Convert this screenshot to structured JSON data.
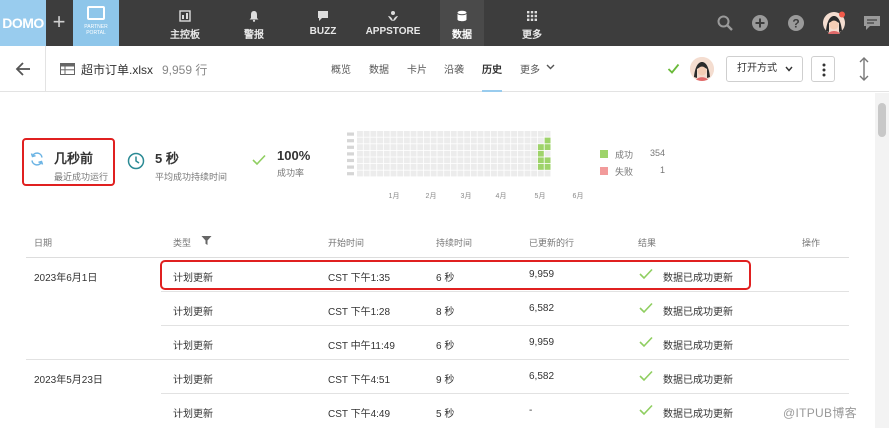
{
  "topnav": {
    "logo": "DOMO",
    "portal": {
      "line1": "PARTNER",
      "line2": "PORTAL"
    },
    "items": [
      {
        "label": "主控板",
        "icon": "dashboard-icon"
      },
      {
        "label": "警报",
        "icon": "bell-icon"
      },
      {
        "label": "BUZZ",
        "icon": "chat-icon"
      },
      {
        "label": "APPSTORE",
        "icon": "appstore-icon"
      },
      {
        "label": "数据",
        "icon": "database-icon",
        "active": true
      },
      {
        "label": "更多",
        "icon": "grid-icon"
      }
    ],
    "right_icons": [
      "search-icon",
      "add-icon",
      "help-icon",
      "avatar",
      "message-icon"
    ]
  },
  "header": {
    "dataset_name": "超市订单.xlsx",
    "row_count": "9,959 行",
    "tabs": [
      {
        "label": "概览"
      },
      {
        "label": "数据"
      },
      {
        "label": "卡片"
      },
      {
        "label": "沿袭"
      },
      {
        "label": "历史",
        "active": true
      },
      {
        "label": "更多"
      }
    ],
    "open_with_label": "打开方式"
  },
  "summary": {
    "last_run": {
      "value": "几秒前",
      "label": "最近成功运行"
    },
    "duration": {
      "value": "5 秒",
      "label": "平均成功持续时间"
    },
    "success_rate": {
      "value": "100%",
      "label": "成功率"
    }
  },
  "chart_data": {
    "type": "heatmap",
    "x_ticks": [
      "1月",
      "2月",
      "3月",
      "4月",
      "5月",
      "6月"
    ],
    "legend": [
      {
        "label": "成功",
        "count": 354,
        "color": "#9ed36a"
      },
      {
        "label": "失败",
        "count": 1,
        "color": "#f29b9b"
      }
    ]
  },
  "table": {
    "headers": [
      "日期",
      "类型",
      "开始时间",
      "持续时间",
      "已更新的行",
      "结果",
      "操作"
    ],
    "groups": [
      {
        "date": "2023年6月1日",
        "rows": [
          {
            "type": "计划更新",
            "start": "CST 下午1:35",
            "duration": "6 秒",
            "rows": "9,959",
            "result": "数据已成功更新"
          },
          {
            "type": "计划更新",
            "start": "CST 下午1:28",
            "duration": "8 秒",
            "rows": "6,582",
            "result": "数据已成功更新"
          },
          {
            "type": "计划更新",
            "start": "CST 中午11:49",
            "duration": "6 秒",
            "rows": "9,959",
            "result": "数据已成功更新"
          }
        ]
      },
      {
        "date": "2023年5月23日",
        "rows": [
          {
            "type": "计划更新",
            "start": "CST 下午4:51",
            "duration": "9 秒",
            "rows": "6,582",
            "result": "数据已成功更新"
          },
          {
            "type": "计划更新",
            "start": "CST 下午4:49",
            "duration": "5 秒",
            "rows": "-",
            "result": "数据已成功更新"
          }
        ]
      }
    ]
  },
  "watermark": "@ITPUB博客"
}
